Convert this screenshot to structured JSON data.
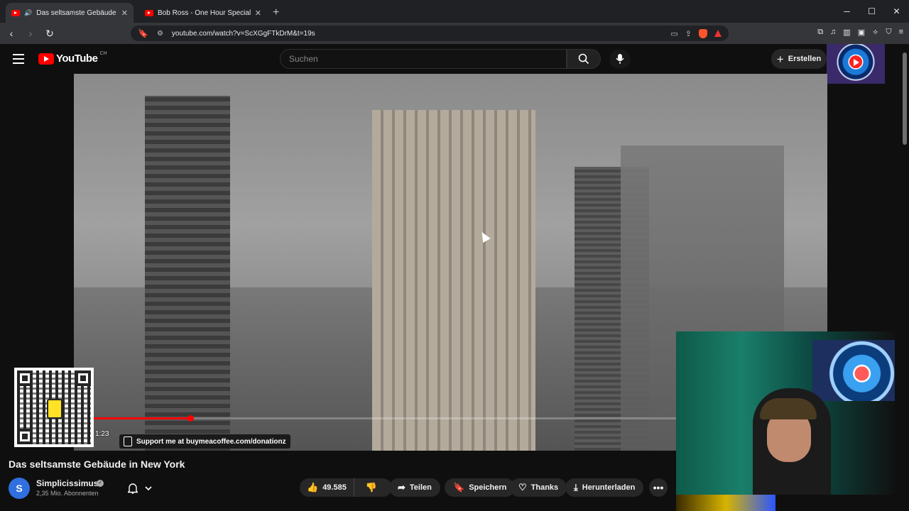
{
  "browser": {
    "tabs": [
      {
        "title": "Das seltsamste Gebäude in N",
        "audio": "🔊",
        "active": true,
        "close": "✕"
      },
      {
        "title": "Bob Ross - One Hour Special - The G",
        "active": false,
        "close": "✕"
      }
    ],
    "new_tab": "+",
    "window_controls": {
      "minimize": "─",
      "maximize": "☐",
      "close": "✕"
    },
    "nav": {
      "back": "‹",
      "forward": "›",
      "reload": "↻"
    },
    "url": "youtube.com/watch?v=ScXGgFTkDrM&t=19s"
  },
  "youtube": {
    "logo_text": "YouTube",
    "country": "CH",
    "search_placeholder": "Suchen",
    "create_label": "Erstellen",
    "create_icon": "+"
  },
  "player": {
    "timecode": "1:23",
    "progress_fraction": 0.155,
    "buffered_fraction": 0.27,
    "overlay_text": "Support me at buymeacoffee.com/donationz"
  },
  "video": {
    "title": "Das seltsamste Gebäude in New York",
    "channel": {
      "initial": "S",
      "name": "Simplicissimus",
      "verified_mark": "✓",
      "subscribers": "2,35 Mio. Abonnenten"
    },
    "actions": {
      "likes": "49.585",
      "share": "Teilen",
      "save": "Speichern",
      "thanks": "Thanks",
      "download": "Herunterladen",
      "more": "•••"
    }
  },
  "colors": {
    "accent": "#ff0000",
    "background": "#0f0f0f",
    "pill": "#272727"
  },
  "icons": [
    "menu-icon",
    "search-icon",
    "mic-icon",
    "plus-icon",
    "bell-icon",
    "chevron-down-icon",
    "thumbs-up-icon",
    "thumbs-down-icon",
    "share-icon",
    "bookmark-icon",
    "thanks-icon",
    "download-icon",
    "more-icon"
  ]
}
